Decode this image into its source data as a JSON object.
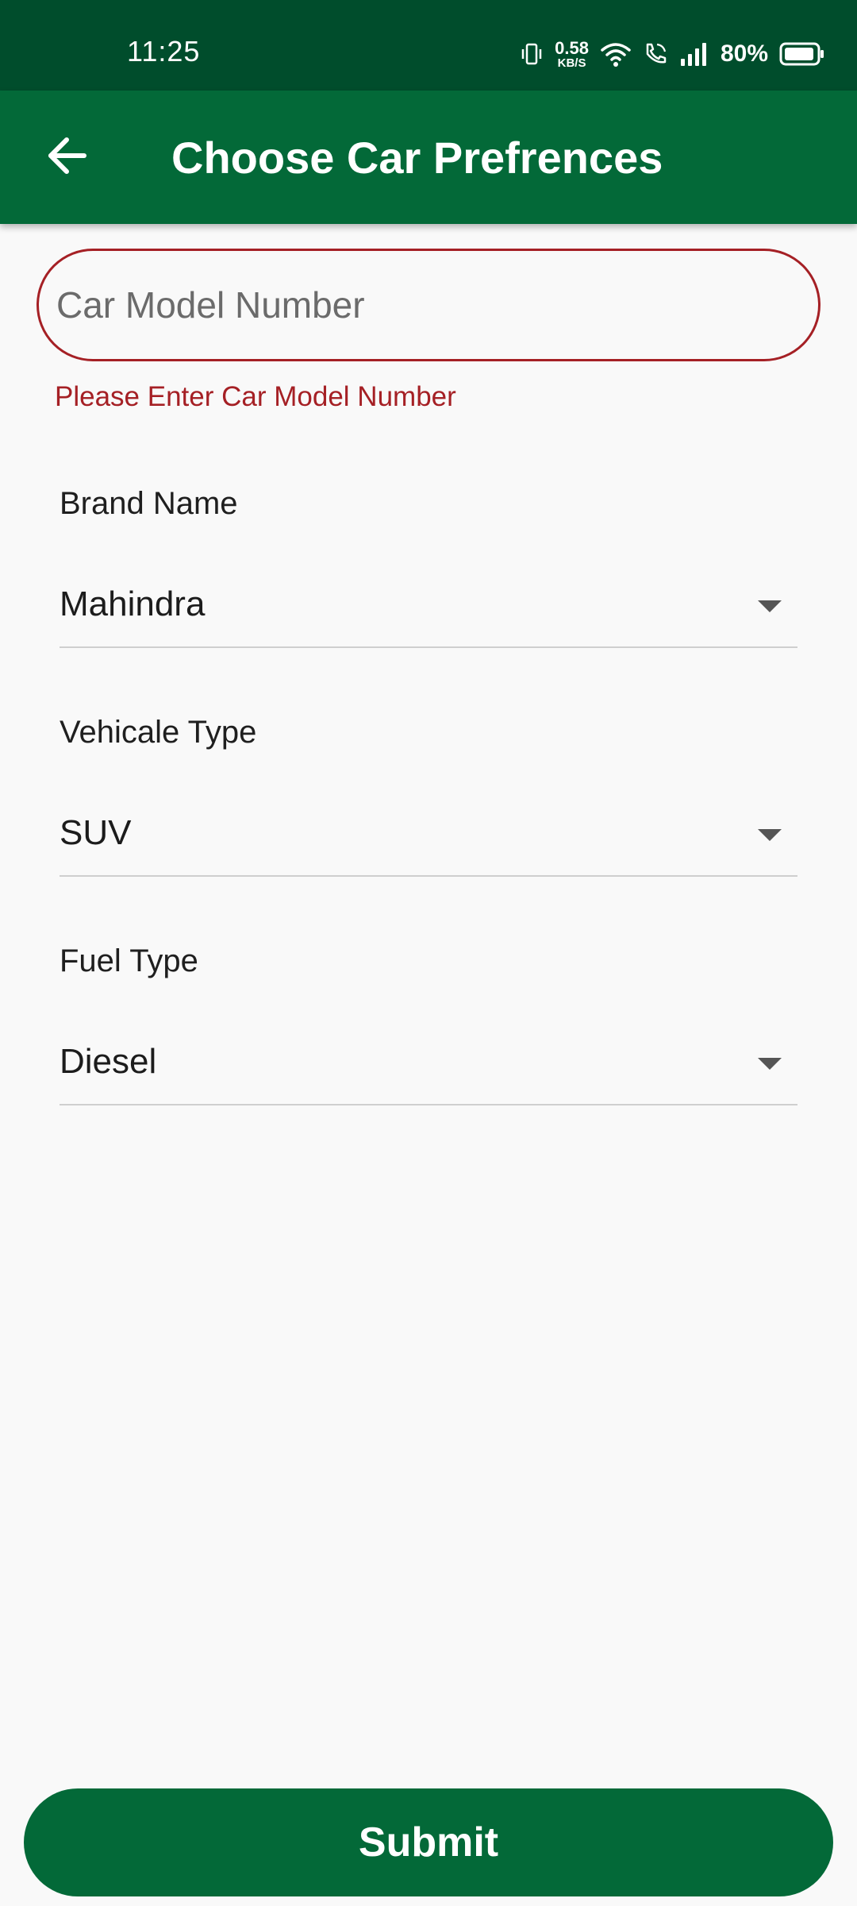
{
  "status_bar": {
    "time": "11:25",
    "net_speed_value": "0.58",
    "net_speed_unit": "KB/S",
    "battery": "80%",
    "icons": [
      "vibrate-icon",
      "wifi-icon",
      "wifi-calling-icon",
      "signal-icon",
      "battery-icon"
    ]
  },
  "app_bar": {
    "title": "Choose Car Prefrences",
    "back_icon": "arrow-left-icon"
  },
  "form": {
    "model_number": {
      "placeholder": "Car Model Number",
      "value": "",
      "error": "Please Enter Car Model Number"
    },
    "brand": {
      "label": "Brand Name",
      "value": "Mahindra"
    },
    "vehicle_type": {
      "label": "Vehicale Type",
      "value": "SUV"
    },
    "fuel_type": {
      "label": "Fuel Type",
      "value": "Diesel"
    },
    "submit_label": "Submit"
  },
  "colors": {
    "status_bar": "#004d2c",
    "primary": "#036938",
    "error": "#a52025",
    "background": "#f9f9f9"
  }
}
